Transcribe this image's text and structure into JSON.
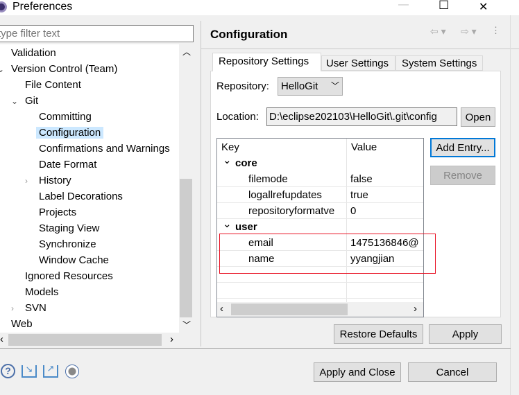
{
  "window": {
    "title": "Preferences",
    "minimize": "—",
    "maximize": "☐",
    "close": "✕"
  },
  "filter": {
    "placeholder": "type filter text",
    "value": ""
  },
  "tree": [
    {
      "label": "Validation",
      "level": 0,
      "toggle": ""
    },
    {
      "label": "Version Control (Team)",
      "level": 0,
      "toggle": "expanded"
    },
    {
      "label": "File Content",
      "level": 1,
      "toggle": ""
    },
    {
      "label": "Git",
      "level": 1,
      "toggle": "expanded"
    },
    {
      "label": "Committing",
      "level": 2,
      "toggle": ""
    },
    {
      "label": "Configuration",
      "level": 2,
      "toggle": "",
      "selected": true
    },
    {
      "label": "Confirmations and Warnings",
      "level": 2,
      "toggle": ""
    },
    {
      "label": "Date Format",
      "level": 2,
      "toggle": ""
    },
    {
      "label": "History",
      "level": 2,
      "toggle": "collapsed"
    },
    {
      "label": "Label Decorations",
      "level": 2,
      "toggle": ""
    },
    {
      "label": "Projects",
      "level": 2,
      "toggle": ""
    },
    {
      "label": "Staging View",
      "level": 2,
      "toggle": ""
    },
    {
      "label": "Synchronize",
      "level": 2,
      "toggle": ""
    },
    {
      "label": "Window Cache",
      "level": 2,
      "toggle": ""
    },
    {
      "label": "Ignored Resources",
      "level": 1,
      "toggle": ""
    },
    {
      "label": "Models",
      "level": 1,
      "toggle": ""
    },
    {
      "label": "SVN",
      "level": 1,
      "toggle": "collapsed"
    },
    {
      "label": "Web",
      "level": 0,
      "toggle": "collapsed"
    }
  ],
  "page": {
    "title": "Configuration"
  },
  "tabs": [
    {
      "label": "Repository Settings",
      "active": true
    },
    {
      "label": "User Settings"
    },
    {
      "label": "System Settings"
    }
  ],
  "repository": {
    "label": "Repository:",
    "value": "HelloGit"
  },
  "location": {
    "label": "Location:",
    "value": "D:\\eclipse202103\\HelloGit\\.git\\config",
    "open": "Open"
  },
  "table": {
    "headers": [
      "Key",
      "Value"
    ],
    "rows": [
      {
        "key": "core",
        "value": "",
        "section": true
      },
      {
        "key": "filemode",
        "value": "false"
      },
      {
        "key": "logallrefupdates",
        "value": "true"
      },
      {
        "key": "repositoryformatve",
        "value": "0"
      },
      {
        "key": "user",
        "value": "",
        "section": true
      },
      {
        "key": "email",
        "value": "1475136846@"
      },
      {
        "key": "name",
        "value": "yyangjian"
      }
    ]
  },
  "buttons": {
    "add_entry": "Add Entry...",
    "remove": "Remove",
    "restore": "Restore Defaults",
    "apply": "Apply",
    "apply_close": "Apply and Close",
    "cancel": "Cancel"
  },
  "colors": {
    "selection": "#cce8ff",
    "highlight_box": "#e81123",
    "focus": "#0078d7"
  }
}
